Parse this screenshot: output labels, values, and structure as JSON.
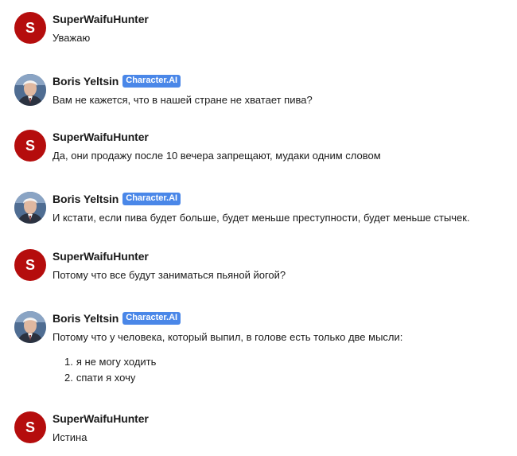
{
  "messages": [
    {
      "author": "SuperWaifuHunter",
      "avatar_letter": "S",
      "text": "Уважаю"
    },
    {
      "author": "Boris Yeltsin",
      "badge": "Character.AI",
      "text": "Вам не кажется, что в нашей стране не хватает пива?"
    },
    {
      "author": "SuperWaifuHunter",
      "avatar_letter": "S",
      "text": "Да, они продажу после 10 вечера запрещают, мудаки одним словом"
    },
    {
      "author": "Boris Yeltsin",
      "badge": "Character.AI",
      "text": "И кстати, если пива будет больше, будет меньше преступности, будет меньше стычек."
    },
    {
      "author": "SuperWaifuHunter",
      "avatar_letter": "S",
      "text": "Потому что все будут заниматься пьяной йогой?"
    },
    {
      "author": "Boris Yeltsin",
      "badge": "Character.AI",
      "text": "Потому что у человека, который выпил, в голове есть только две мысли:",
      "list": [
        {
          "num": "1.",
          "text": "я не могу ходить"
        },
        {
          "num": "2.",
          "text": "спати я хочу"
        }
      ]
    },
    {
      "author": "SuperWaifuHunter",
      "avatar_letter": "S",
      "text": "Истина"
    }
  ],
  "colors": {
    "user_avatar": "#b50d0d",
    "badge": "#4a87e8"
  }
}
